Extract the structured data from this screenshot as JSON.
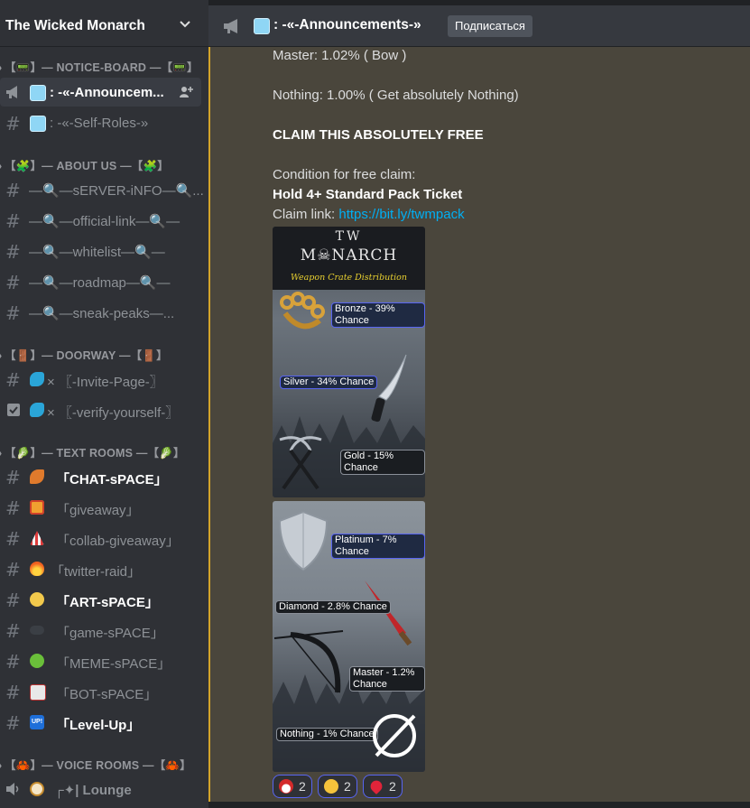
{
  "server": {
    "name": "The Wicked Monarch"
  },
  "header": {
    "channel_title": ": -«-Announcements-»",
    "subscribe_label": "Подписаться"
  },
  "categories": {
    "notice": "【📟】— NOTICE-BOARD —【📟】",
    "about": "【🧩】— ABOUT US —【🧩】",
    "doorway": "【🚪】— DOORWAY —【🚪】",
    "text": "【🥬】— TEXT ROOMS —【🥬】",
    "voice": "【🦀】— VOICE ROOMS —【🦀】"
  },
  "channels": {
    "announcements": ": -«-Announcem...",
    "self_roles": ": -«-Self-Roles-»",
    "server_info": "—🔍—sERVER-iNFO—🔍...",
    "official_link": "—🔍—official-link—🔍—",
    "whitelist": "—🔍—whitelist—🔍—",
    "roadmap": "—🔍—roadmap—🔍—",
    "sneak_peaks": "—🔍—sneak-peaks—...",
    "invite_page": "× 〖-Invite-Page-〗",
    "verify": "× 〖-verify-yourself-〗",
    "chat_space": "「CHAT-sPACE」",
    "giveaway": "「giveaway」",
    "collab_giveaway": "「collab-giveaway」",
    "twitter_raid": "「twitter-raid」",
    "art_space": "「ART-sPACE」",
    "game_space": "「game-sPACE」",
    "meme_space": "「MEME-sPACE」",
    "bot_space": "「BOT-sPACE」",
    "level_up": "「Level-Up」",
    "lounge": "┌✦| Lounge"
  },
  "message": {
    "master_line": "Master: 1.02% ( Bow )",
    "nothing_line": "Nothing: 1.00% ( Get absolutely Nothing)",
    "claim_heading": "CLAIM THIS ABSOLUTELY FREE",
    "condition_label": "Condition for free claim:",
    "condition_value": "Hold 4+ Standard Pack Ticket",
    "claim_link_label": "Claim link: ",
    "claim_link_url": "https://bit.ly/twmpack"
  },
  "image1": {
    "logo_top": "TW",
    "logo_bottom": "M☠NARCH",
    "subtitle": "Weapon Crate Distribution",
    "bronze": "Bronze - 39% Chance",
    "silver": "Silver - 34% Chance",
    "gold": "Gold - 15% Chance"
  },
  "image2": {
    "platinum": "Platinum - 7% Chance",
    "diamond": "Diamond - 2.8% Chance",
    "master": "Master - 1.2% Chance",
    "nothing": "Nothing - 1% Chance"
  },
  "reactions": [
    {
      "count": "2",
      "icon": "santa-icon"
    },
    {
      "count": "2",
      "icon": "money-mouth-face-icon"
    },
    {
      "count": "2",
      "icon": "red-heart-icon"
    }
  ],
  "colors": {
    "accent": "#d4a42a",
    "link": "#00aff4",
    "blurple": "#5865f2",
    "sidebar": "#2f3136"
  }
}
